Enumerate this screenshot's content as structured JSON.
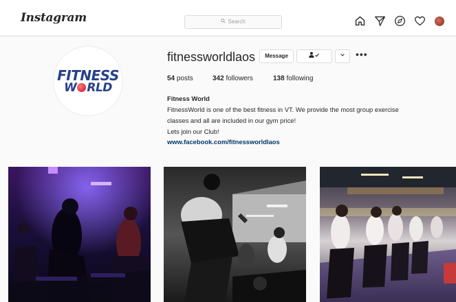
{
  "header": {
    "logo_text": "Instagram",
    "search_placeholder": "Search",
    "icons": [
      "home-icon",
      "direct-icon",
      "explore-icon",
      "activity-heart-icon",
      "profile-avatar-icon"
    ]
  },
  "profile": {
    "username": "fitnessworldlaos",
    "message_button": "Message",
    "follow_icon": "person-check-icon",
    "dropdown_icon": "chevron-down-icon",
    "more_label": "•••",
    "logo_line1": "FITNESS",
    "logo_line2_a": "W",
    "logo_line2_b": "RLD",
    "stats": {
      "posts_count": "54",
      "posts_label": "posts",
      "followers_count": "342",
      "followers_label": "followers",
      "following_count": "138",
      "following_label": "following"
    },
    "bio": {
      "name": "Fitness World",
      "line1": "FitnessWorld is one of the best fitness in VT. We provide the most group exercise",
      "line2": "classes and all are included in our gym price!",
      "line3": "Lets join our Club!",
      "link": "www.facebook.com/fitnessworldlaos"
    }
  },
  "colors": {
    "brand_blue": "#27408b",
    "brand_red": "#c8102e",
    "link": "#00376b",
    "border": "#dbdbdb",
    "background": "#fafafa"
  },
  "posts": [
    {
      "description": "spin class under purple light"
    },
    {
      "description": "black and white spin class"
    },
    {
      "description": "bright studio spin class"
    }
  ]
}
